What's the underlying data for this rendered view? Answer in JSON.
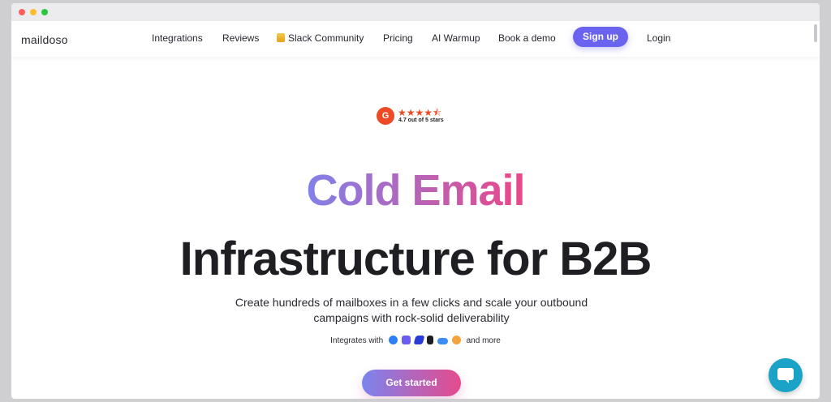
{
  "brand": {
    "logo": "maildoso"
  },
  "nav": {
    "items": [
      {
        "label": "Integrations"
      },
      {
        "label": "Reviews"
      },
      {
        "label": "Slack Community"
      },
      {
        "label": "Pricing"
      },
      {
        "label": "AI Warmup"
      },
      {
        "label": "Book a demo"
      }
    ],
    "signup": "Sign up",
    "login": "Login"
  },
  "rating": {
    "badge": "G",
    "stars": "★★★★⯪",
    "value": 4.7,
    "text": "4.7 out of 5 stars"
  },
  "hero": {
    "headline_1": "Cold Email",
    "headline_2": "Infrastructure for B2B",
    "subtitle": "Create hundreds of mailboxes in a few clicks and scale your outbound campaigns with rock-solid deliverability",
    "integrates_prefix": "Integrates with",
    "integrates_suffix": "and more",
    "cta": "Get started"
  },
  "icons": {
    "integrations": [
      "integration-icon-1",
      "integration-icon-2",
      "integration-icon-3",
      "integration-icon-4",
      "integration-icon-5",
      "integration-icon-6"
    ],
    "chat": "chat-icon"
  },
  "colors": {
    "accent": "#6a63f0",
    "gradient_start": "#7b84ee",
    "gradient_end": "#e64a8d",
    "g2": "#ef4a26",
    "chat": "#1aa3c7"
  }
}
